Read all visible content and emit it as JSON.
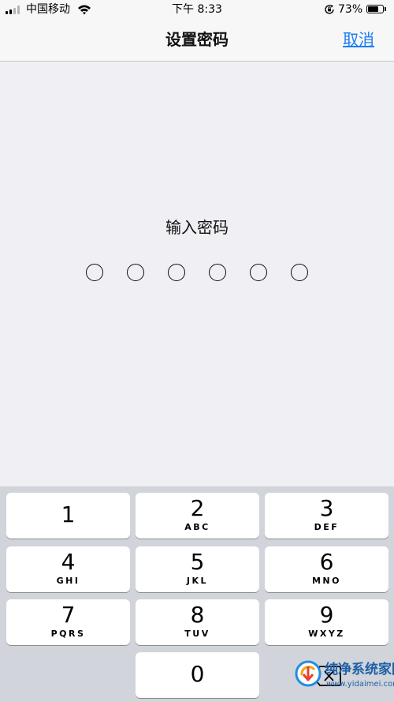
{
  "status_bar": {
    "carrier": "中国移动",
    "time": "下午 8:33",
    "battery_percent": "73%",
    "battery_level": 0.73,
    "signal_bars_active": 2,
    "signal_bars_total": 4,
    "icons": [
      "signal-icon",
      "wifi-icon",
      "orientation-lock-icon",
      "battery-icon"
    ]
  },
  "nav": {
    "title": "设置密码",
    "cancel_label": "取消"
  },
  "passcode": {
    "prompt": "输入密码",
    "length": 6,
    "entered": 0
  },
  "keypad": {
    "keys": [
      {
        "digit": "1",
        "letters": ""
      },
      {
        "digit": "2",
        "letters": "ABC"
      },
      {
        "digit": "3",
        "letters": "DEF"
      },
      {
        "digit": "4",
        "letters": "GHI"
      },
      {
        "digit": "5",
        "letters": "JKL"
      },
      {
        "digit": "6",
        "letters": "MNO"
      },
      {
        "digit": "7",
        "letters": "PQRS"
      },
      {
        "digit": "8",
        "letters": "TUV"
      },
      {
        "digit": "9",
        "letters": "WXYZ"
      },
      {
        "digit": "0",
        "letters": ""
      }
    ],
    "delete_icon": "delete-icon"
  },
  "watermark": {
    "title": "纯净系统家园",
    "url": "www.yidaimei.com"
  },
  "colors": {
    "accent": "#1a7cf4",
    "background": "#efeff4",
    "keypad_background": "#d1d4da",
    "watermark": "#1f5fa8"
  }
}
